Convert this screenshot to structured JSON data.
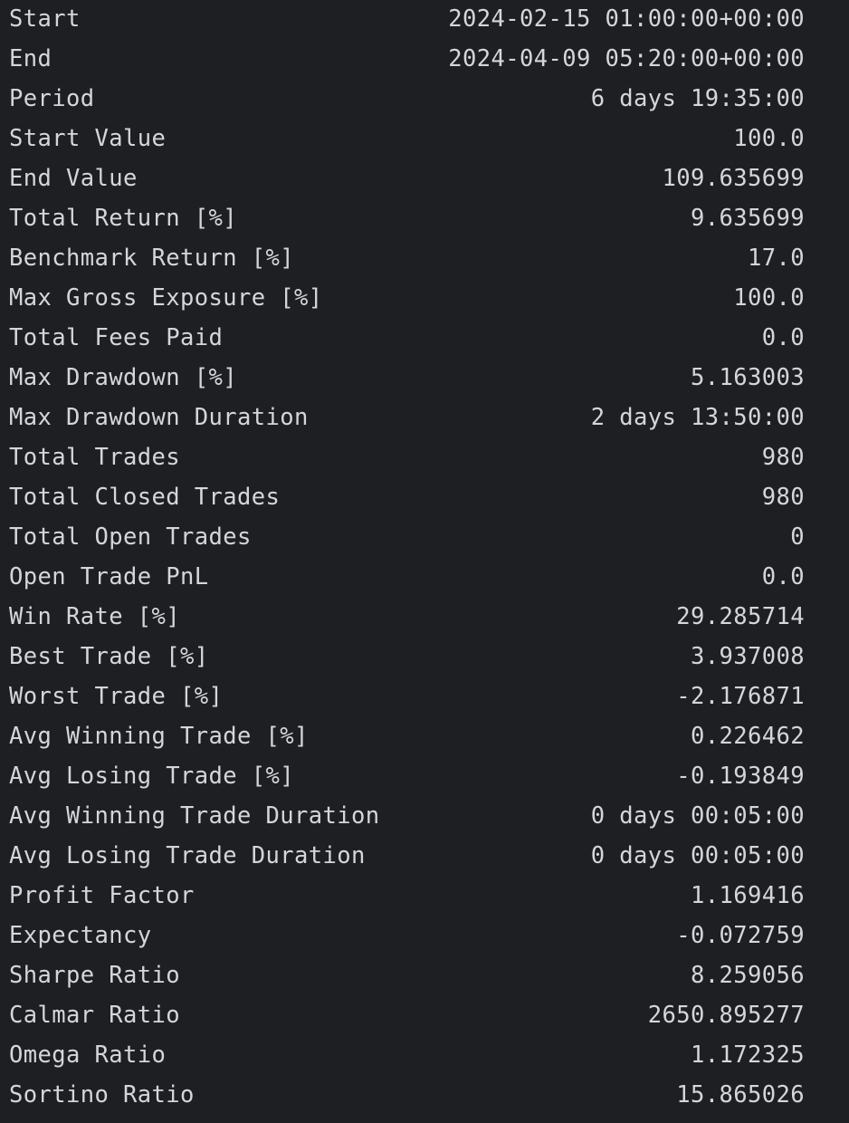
{
  "stats": [
    {
      "label": "Start",
      "value": "2024-02-15 01:00:00+00:00"
    },
    {
      "label": "End",
      "value": "2024-04-09 05:20:00+00:00"
    },
    {
      "label": "Period",
      "value": "6 days 19:35:00"
    },
    {
      "label": "Start Value",
      "value": "100.0"
    },
    {
      "label": "End Value",
      "value": "109.635699"
    },
    {
      "label": "Total Return [%]",
      "value": "9.635699"
    },
    {
      "label": "Benchmark Return [%]",
      "value": "17.0"
    },
    {
      "label": "Max Gross Exposure [%]",
      "value": "100.0"
    },
    {
      "label": "Total Fees Paid",
      "value": "0.0"
    },
    {
      "label": "Max Drawdown [%]",
      "value": "5.163003"
    },
    {
      "label": "Max Drawdown Duration",
      "value": "2 days 13:50:00"
    },
    {
      "label": "Total Trades",
      "value": "980"
    },
    {
      "label": "Total Closed Trades",
      "value": "980"
    },
    {
      "label": "Total Open Trades",
      "value": "0"
    },
    {
      "label": "Open Trade PnL",
      "value": "0.0"
    },
    {
      "label": "Win Rate [%]",
      "value": "29.285714"
    },
    {
      "label": "Best Trade [%]",
      "value": "3.937008"
    },
    {
      "label": "Worst Trade [%]",
      "value": "-2.176871"
    },
    {
      "label": "Avg Winning Trade [%]",
      "value": "0.226462"
    },
    {
      "label": "Avg Losing Trade [%]",
      "value": "-0.193849"
    },
    {
      "label": "Avg Winning Trade Duration",
      "value": "0 days 00:05:00"
    },
    {
      "label": "Avg Losing Trade Duration",
      "value": "0 days 00:05:00"
    },
    {
      "label": "Profit Factor",
      "value": "1.169416"
    },
    {
      "label": "Expectancy",
      "value": "-0.072759"
    },
    {
      "label": "Sharpe Ratio",
      "value": "8.259056"
    },
    {
      "label": "Calmar Ratio",
      "value": "2650.895277"
    },
    {
      "label": "Omega Ratio",
      "value": "1.172325"
    },
    {
      "label": "Sortino Ratio",
      "value": "15.865026"
    }
  ]
}
